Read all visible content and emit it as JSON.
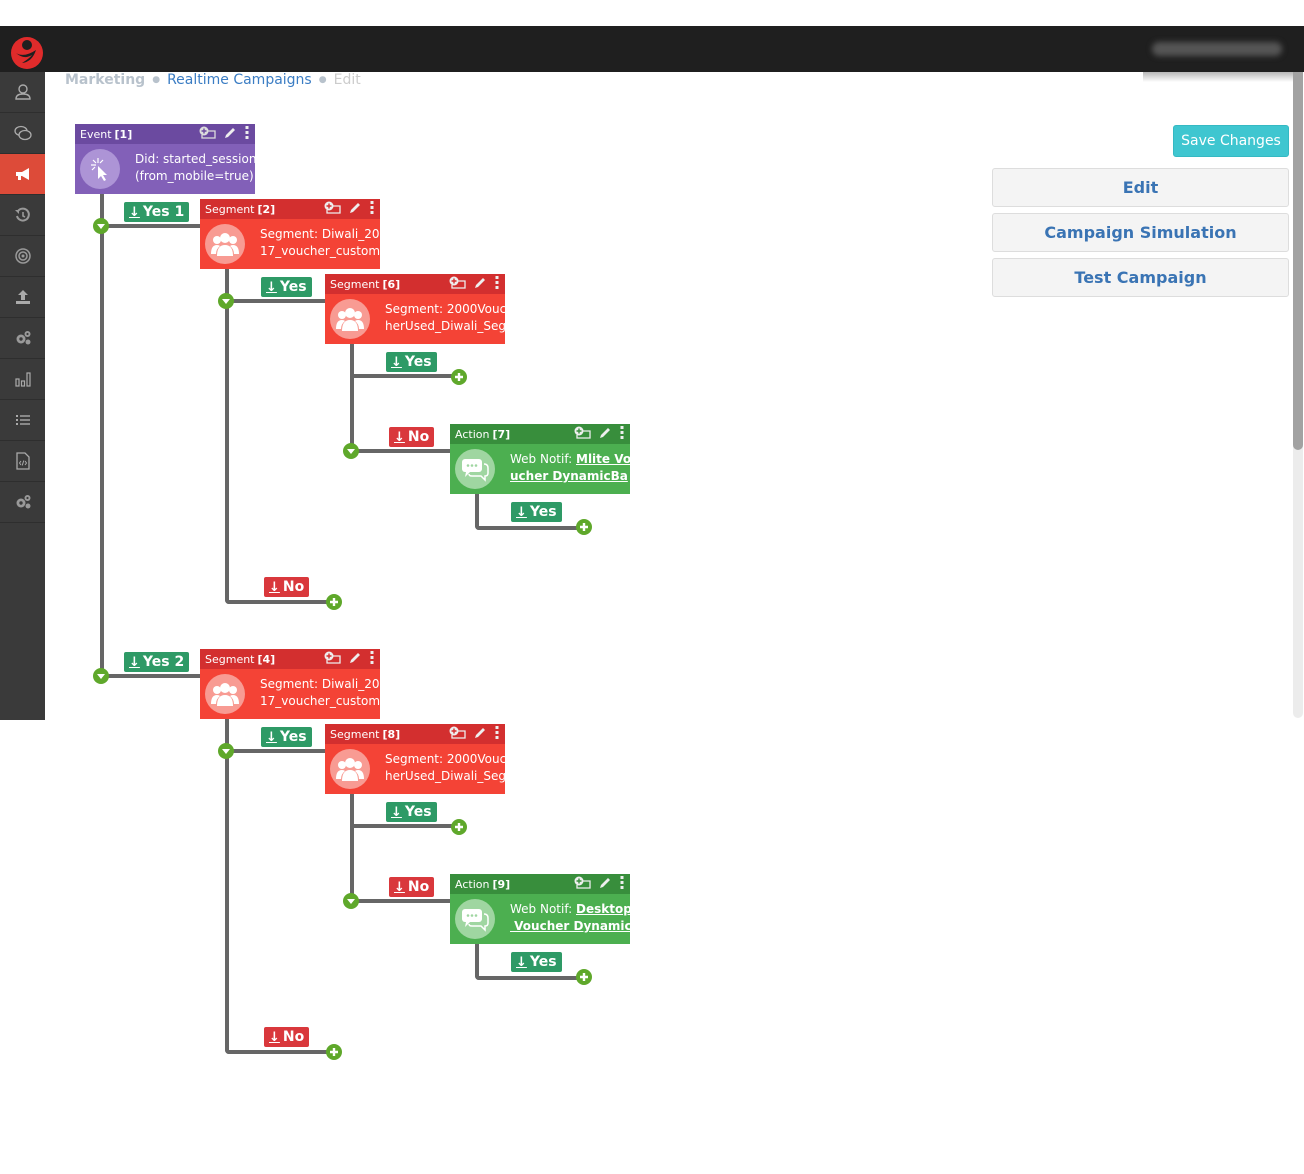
{
  "header": {
    "user_blurred": "admin@sandbox"
  },
  "sidebar": {
    "items": [
      {
        "name": "user-icon",
        "active": false
      },
      {
        "name": "chat-icon",
        "active": false
      },
      {
        "name": "megaphone-icon",
        "active": true
      },
      {
        "name": "history-icon",
        "active": false
      },
      {
        "name": "target-icon",
        "active": false
      },
      {
        "name": "upload-icon",
        "active": false
      },
      {
        "name": "gears-icon",
        "active": false
      },
      {
        "name": "bar-chart-icon",
        "active": false
      },
      {
        "name": "list-icon",
        "active": false
      },
      {
        "name": "code-file-icon",
        "active": false
      },
      {
        "name": "settings-icon",
        "active": false
      }
    ]
  },
  "breadcrumb": {
    "root": "Marketing",
    "section": "Realtime Campaigns",
    "current": "Edit"
  },
  "actions": {
    "save": "Save Changes",
    "edit": "Edit",
    "simulation": "Campaign Simulation",
    "test": "Test Campaign"
  },
  "tree": {
    "event": {
      "type": "Event",
      "id": "[1]",
      "line1": "Did: started_session",
      "line2": "(from_mobile=true)"
    },
    "branches": [
      {
        "label": "Yes 1",
        "segment": {
          "type": "Segment",
          "id": "[2]",
          "line1": "Segment: Diwali_20",
          "line2": "17_voucher_custom"
        },
        "yes_label": "Yes",
        "sub_segment": {
          "type": "Segment",
          "id": "[6]",
          "line1": "Segment: 2000Vouc",
          "line2": "herUsed_Diwali_Seg"
        },
        "sub_yes_label": "Yes",
        "sub_no_label": "No",
        "action": {
          "type": "Action",
          "id": "[7]",
          "prefix": "Web Notif: ",
          "link1": "Mlite Vo",
          "link2": "ucher DynamicBa"
        },
        "action_yes_label": "Yes",
        "no_label": "No"
      },
      {
        "label": "Yes 2",
        "segment": {
          "type": "Segment",
          "id": "[4]",
          "line1": "Segment: Diwali_20",
          "line2": "17_voucher_custom"
        },
        "yes_label": "Yes",
        "sub_segment": {
          "type": "Segment",
          "id": "[8]",
          "line1": "Segment: 2000Vouc",
          "line2": "herUsed_Diwali_Seg"
        },
        "sub_yes_label": "Yes",
        "sub_no_label": "No",
        "action": {
          "type": "Action",
          "id": "[9]",
          "prefix": "Web Notif: ",
          "link1": "Desktop",
          "link2": " Voucher Dynamic"
        },
        "action_yes_label": "Yes",
        "no_label": "No"
      }
    ]
  },
  "colors": {
    "event": "#8260b8",
    "segment": "#f44336",
    "action": "#4caf50",
    "yes": "#2e9a66",
    "no": "#d9383c",
    "accent": "#3fc6d0",
    "sidebar_active": "#dd4b39"
  }
}
